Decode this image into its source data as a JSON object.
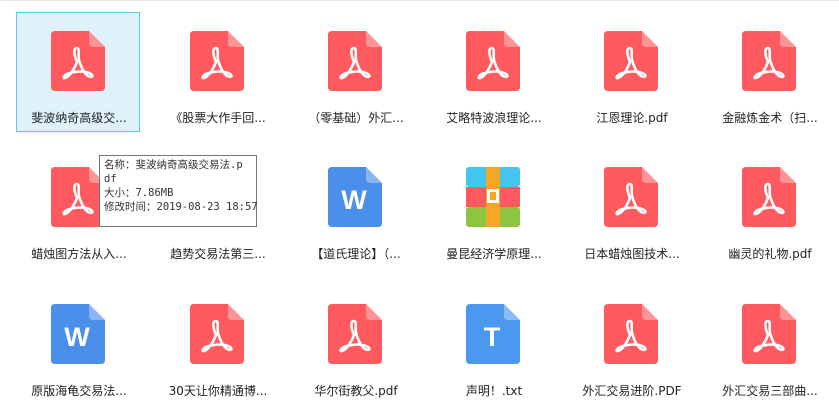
{
  "files": [
    {
      "name": "斐波纳奇高级交...",
      "icon": "pdf-icon",
      "selected": true
    },
    {
      "name": "《股票大作手回...",
      "icon": "pdf-icon"
    },
    {
      "name": "（零基础）外汇...",
      "icon": "pdf-icon"
    },
    {
      "name": "艾略特波浪理论...",
      "icon": "pdf-icon"
    },
    {
      "name": "江恩理论.pdf",
      "icon": "pdf-icon"
    },
    {
      "name": "金融炼金术（扫...",
      "icon": "pdf-icon"
    },
    {
      "name": "蜡烛图方法从入...",
      "icon": "pdf-icon"
    },
    {
      "name": "趋势交易法第三...",
      "icon": "pdf-icon"
    },
    {
      "name": "【道氏理论】（...",
      "icon": "word-icon"
    },
    {
      "name": "曼昆经济学原理...",
      "icon": "archive-icon"
    },
    {
      "name": "日本蜡烛图技术...",
      "icon": "pdf-icon"
    },
    {
      "name": "幽灵的礼物.pdf",
      "icon": "pdf-icon"
    },
    {
      "name": "原版海龟交易法...",
      "icon": "word-icon"
    },
    {
      "name": "30天让你精通博...",
      "icon": "pdf-icon"
    },
    {
      "name": "华尔街教父.pdf",
      "icon": "pdf-icon"
    },
    {
      "name": "声明！.txt",
      "icon": "text-icon"
    },
    {
      "name": "外汇交易进阶.PDF",
      "icon": "pdf-icon"
    },
    {
      "name": "外汇交易三部曲...",
      "icon": "pdf-icon"
    }
  ],
  "tooltip": {
    "name_line": "名称：斐波纳奇高级交易法.p",
    "name_line2": "df",
    "size_line": "大小：7.86MB",
    "modified_line": "修改时间：2019-08-23 18:57"
  },
  "colors": {
    "pdf": "#ff5a5f",
    "word": "#4a90ea",
    "text": "#4a98f0",
    "selection_bg": "#dff2fb",
    "selection_border": "#62c7ea"
  }
}
